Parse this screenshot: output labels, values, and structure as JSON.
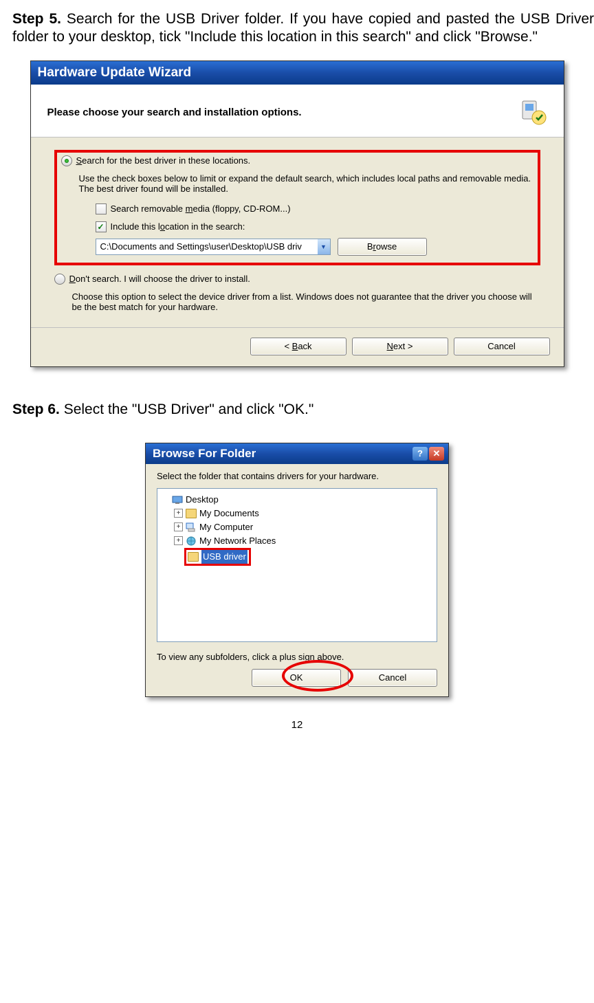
{
  "step5": {
    "label": "Step 5.",
    "body": "Search for the USB Driver folder. If you have copied and pasted the USB Driver folder to your desktop, tick \"Include this location in this search\" and click \"Browse.\""
  },
  "wizard": {
    "title": "Hardware Update Wizard",
    "heading": "Please choose your search and installation options.",
    "opt_search_prefix": "S",
    "opt_search_rest": "earch for the best driver in these locations.",
    "opt_search_sub": "Use the check boxes below to limit or expand the default search, which includes local paths and removable media. The best driver found will be installed.",
    "chk_media_pre": "Search removable ",
    "chk_media_u": "m",
    "chk_media_post": "edia (floppy, CD-ROM...)",
    "chk_loc_pre": "Include this l",
    "chk_loc_u": "o",
    "chk_loc_post": "cation in the search:",
    "path_value": "C:\\Documents and Settings\\user\\Desktop\\USB driv",
    "browse_pre": "B",
    "browse_u": "r",
    "browse_post": "owse",
    "opt_dont_prefix": "D",
    "opt_dont_rest": "on't search. I will choose the driver to install.",
    "opt_dont_sub": "Choose this option to select the device driver from a list.  Windows does not guarantee that the driver you choose will be the best match for your hardware.",
    "back_pre": "< ",
    "back_u": "B",
    "back_post": "ack",
    "next_u": "N",
    "next_post": "ext >",
    "cancel": "Cancel"
  },
  "step6": {
    "label": "Step 6.",
    "body": "Select the \"USB Driver\" and click \"OK.\""
  },
  "bff": {
    "title": "Browse For Folder",
    "hint": "Select the folder that contains drivers for your hardware.",
    "desktop": "Desktop",
    "mydocs": "My Documents",
    "mycomp": "My Computer",
    "mynet": "My Network Places",
    "usb": "USB driver",
    "subhint": "To view any subfolders, click a plus sign above.",
    "ok": "OK",
    "cancel": "Cancel"
  },
  "pagenum": "12"
}
